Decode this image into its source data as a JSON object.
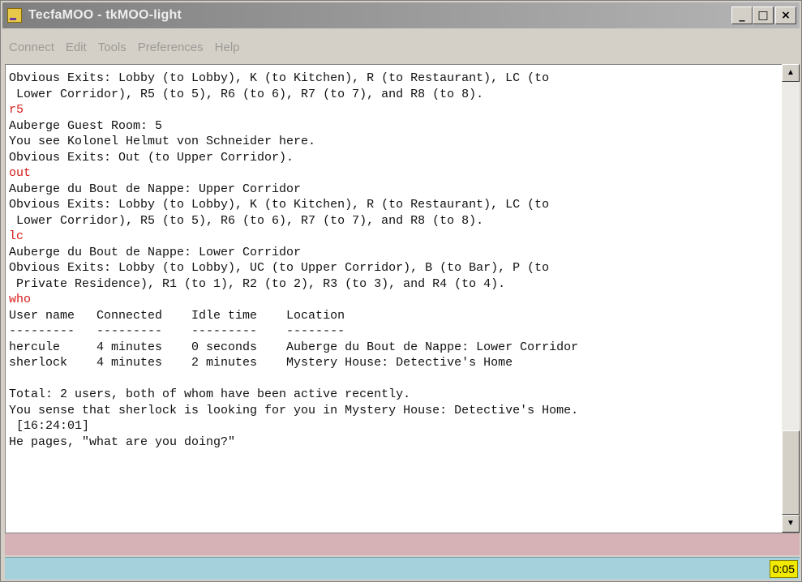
{
  "window": {
    "title": "TecfaMOO - tkMOO-light"
  },
  "title_controls": {
    "minimize": "_",
    "maximize": "□",
    "close": "×"
  },
  "menu": {
    "items": [
      "Connect",
      "Edit",
      "Tools",
      "Preferences",
      "Help"
    ]
  },
  "output": {
    "lines": [
      {
        "type": "text",
        "text": "Obvious Exits: Lobby (to Lobby), K (to Kitchen), R (to Restaurant), LC (to"
      },
      {
        "type": "text",
        "text": " Lower Corridor), R5 (to 5), R6 (to 6), R7 (to 7), and R8 (to 8)."
      },
      {
        "type": "cmd",
        "text": "r5"
      },
      {
        "type": "text",
        "text": "Auberge Guest Room: 5"
      },
      {
        "type": "text",
        "text": "You see Kolonel Helmut von Schneider here."
      },
      {
        "type": "text",
        "text": "Obvious Exits: Out (to Upper Corridor)."
      },
      {
        "type": "cmd",
        "text": "out"
      },
      {
        "type": "text",
        "text": "Auberge du Bout de Nappe: Upper Corridor"
      },
      {
        "type": "text",
        "text": "Obvious Exits: Lobby (to Lobby), K (to Kitchen), R (to Restaurant), LC (to"
      },
      {
        "type": "text",
        "text": " Lower Corridor), R5 (to 5), R6 (to 6), R7 (to 7), and R8 (to 8)."
      },
      {
        "type": "cmd",
        "text": "lc"
      },
      {
        "type": "text",
        "text": "Auberge du Bout de Nappe: Lower Corridor"
      },
      {
        "type": "text",
        "text": "Obvious Exits: Lobby (to Lobby), UC (to Upper Corridor), B (to Bar), P (to"
      },
      {
        "type": "text",
        "text": " Private Residence), R1 (to 1), R2 (to 2), R3 (to 3), and R4 (to 4)."
      },
      {
        "type": "cmd",
        "text": "who"
      },
      {
        "type": "text",
        "text": "User name   Connected    Idle time    Location"
      },
      {
        "type": "text",
        "text": "---------   ---------    ---------    --------"
      },
      {
        "type": "text",
        "text": "hercule     4 minutes    0 seconds    Auberge du Bout de Nappe: Lower Corridor"
      },
      {
        "type": "text",
        "text": "sherlock    4 minutes    2 minutes    Mystery House: Detective's Home"
      },
      {
        "type": "text",
        "text": ""
      },
      {
        "type": "text",
        "text": "Total: 2 users, both of whom have been active recently."
      },
      {
        "type": "text",
        "text": "You sense that sherlock is looking for you in Mystery House: Detective's Home."
      },
      {
        "type": "text",
        "text": " [16:24:01]"
      },
      {
        "type": "text",
        "text": "He pages, \"what are you doing?\""
      }
    ]
  },
  "scrollbar": {
    "up_arrow": "▲",
    "down_arrow": "▼"
  },
  "input": {
    "value": ""
  },
  "status": {
    "clock": "0:05"
  },
  "colors": {
    "command_text": "#d81b1b",
    "input_line_bg": "#d6b1b6",
    "status_bar_bg": "#a5d1dc",
    "clock_bg": "#f2e900"
  }
}
